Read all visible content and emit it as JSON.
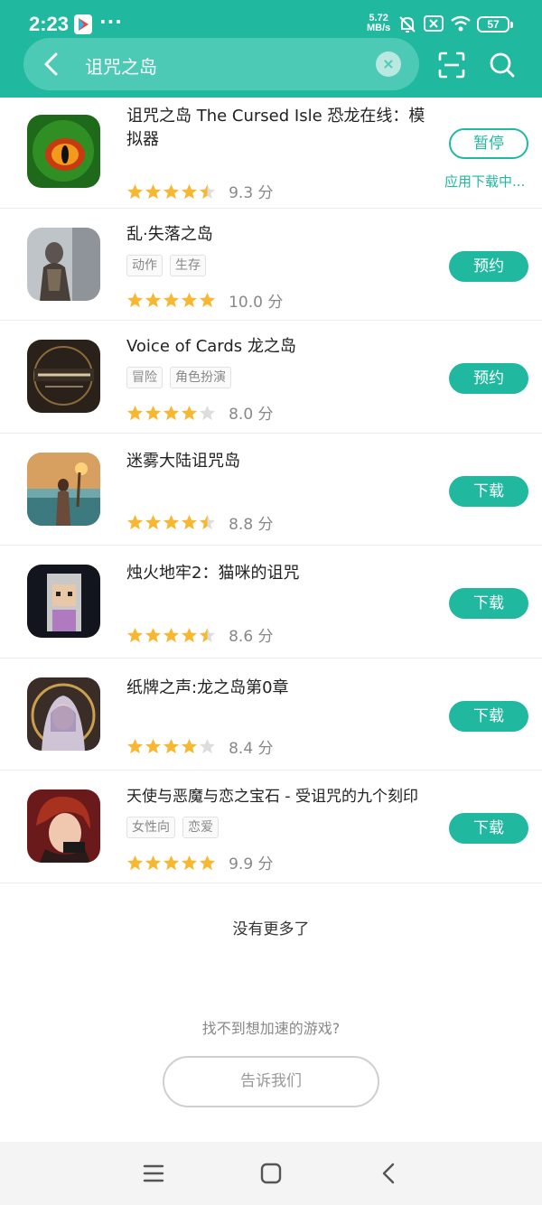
{
  "status_bar": {
    "time": "2:23",
    "net_speed_value": "5.72",
    "net_speed_unit": "MB/s",
    "battery": "57",
    "dots": "···"
  },
  "search": {
    "query": "诅咒之岛",
    "clear_symbol": "×"
  },
  "colors": {
    "accent": "#21b8a0",
    "star": "#f7b731",
    "star_empty": "#dddddd"
  },
  "apps": [
    {
      "name": "诅咒之岛 The Cursed Isle 恐龙在线：模拟器",
      "tags": [],
      "rating": 4.5,
      "score": "9.3 分",
      "action": "暂停",
      "status": "应用下载中..."
    },
    {
      "name": "乱·失落之岛",
      "tags": [
        "动作",
        "生存"
      ],
      "rating": 5,
      "score": "10.0 分",
      "action": "预约"
    },
    {
      "name": "Voice of Cards 龙之岛",
      "tags": [
        "冒险",
        "角色扮演"
      ],
      "rating": 4,
      "score": "8.0 分",
      "action": "预约"
    },
    {
      "name": "迷雾大陆诅咒岛",
      "tags": [],
      "rating": 4.5,
      "score": "8.8 分",
      "action": "下载"
    },
    {
      "name": "烛火地牢2：猫咪的诅咒",
      "tags": [],
      "rating": 4.5,
      "score": "8.6 分",
      "action": "下载"
    },
    {
      "name": "纸牌之声:龙之岛第0章",
      "tags": [],
      "rating": 4,
      "score": "8.4 分",
      "action": "下载"
    },
    {
      "name": "天使与恶魔与恋之宝石 - 受诅咒的九个刻印",
      "tags": [
        "女性向",
        "恋爱"
      ],
      "rating": 5,
      "score": "9.9 分",
      "action": "下载"
    }
  ],
  "footer": {
    "no_more": "没有更多了",
    "hint": "找不到想加速的游戏?",
    "tell_us": "告诉我们"
  }
}
